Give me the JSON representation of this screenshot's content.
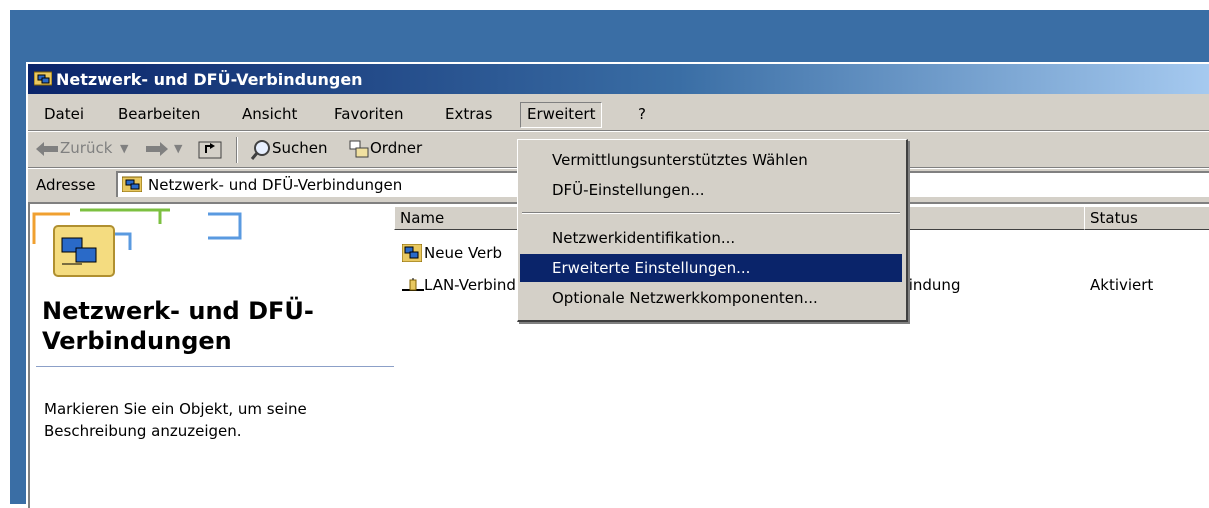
{
  "window": {
    "title": "Netzwerk- und DFÜ-Verbindungen"
  },
  "menubar": {
    "items": [
      {
        "label": "Datei"
      },
      {
        "label": "Bearbeiten"
      },
      {
        "label": "Ansicht"
      },
      {
        "label": "Favoriten"
      },
      {
        "label": "Extras"
      },
      {
        "label": "Erweitert"
      },
      {
        "label": "?"
      }
    ]
  },
  "toolbar": {
    "back_label": "Zurück",
    "search_label": "Suchen",
    "folders_label": "Ordner"
  },
  "addressbar": {
    "label": "Adresse",
    "value": "Netzwerk- und DFÜ-Verbindungen"
  },
  "leftpane": {
    "title": "Netzwerk- und DFÜ-Verbindungen",
    "description": "Markieren Sie ein Objekt, um seine Beschreibung anzuzeigen."
  },
  "list": {
    "columns": [
      "Name",
      "Status"
    ],
    "rows": [
      {
        "name": "Neue Verb",
        "type": "",
        "status": ""
      },
      {
        "name": "LAN-Verbindung",
        "type": "LAN-Verbindung",
        "status": "Aktiviert"
      }
    ]
  },
  "dropdown": {
    "items": [
      {
        "label": "Vermittlungsunterstütztes Wählen"
      },
      {
        "label": "DFÜ-Einstellungen..."
      },
      {
        "label": "Netzwerkidentifikation..."
      },
      {
        "label": "Erweiterte Einstellungen..."
      },
      {
        "label": "Optionale Netzwerkkomponenten..."
      }
    ],
    "selected": "Erweiterte Einstellungen..."
  },
  "colors": {
    "titlebar": "#0a246a",
    "selection": "#0a246a",
    "desktop": "#3a6ea5",
    "chrome": "#d4d0c8"
  }
}
